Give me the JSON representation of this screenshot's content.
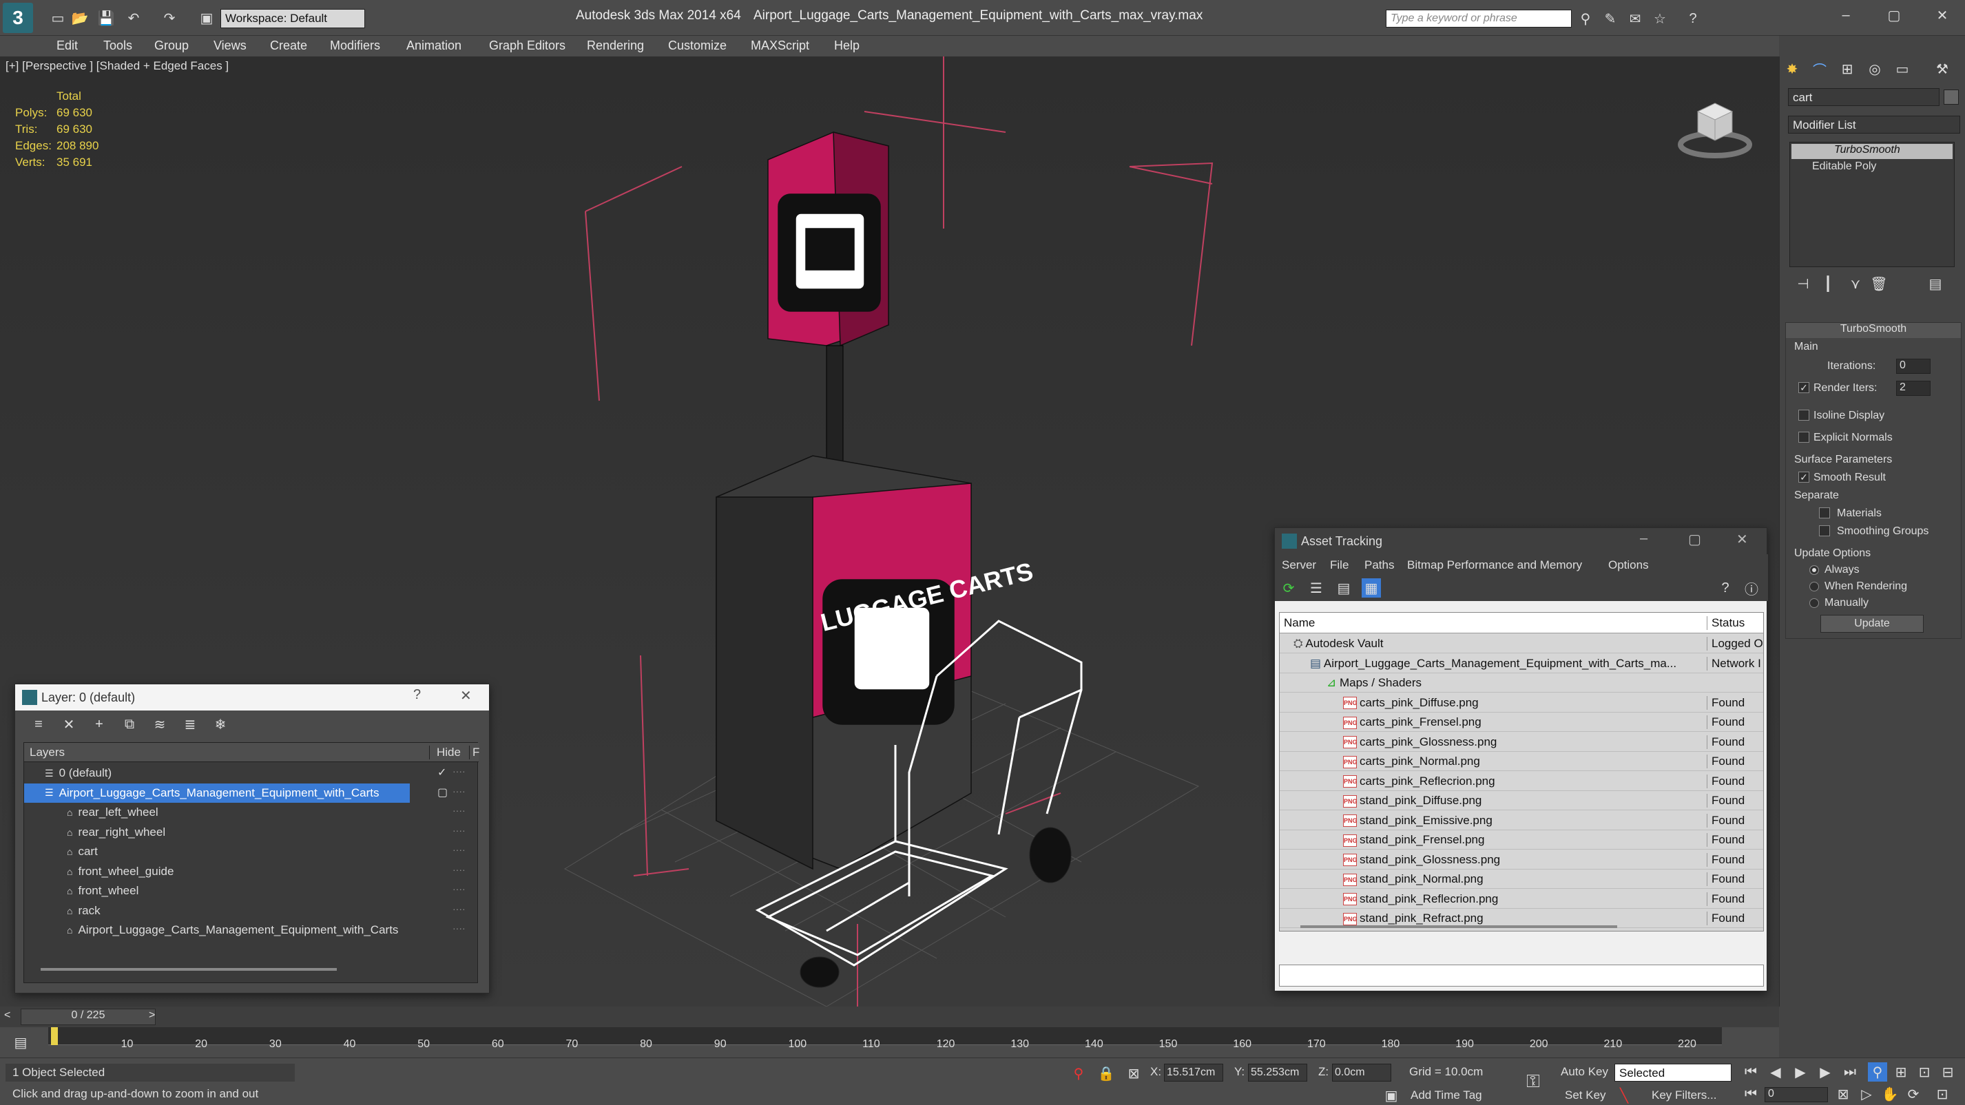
{
  "titlebar": {
    "app": "Autodesk 3ds Max  2014 x64",
    "file": "Airport_Luggage_Carts_Management_Equipment_with_Carts_max_vray.max",
    "workspace": "Workspace: Default",
    "search_placeholder": "Type a keyword or phrase"
  },
  "menu": [
    "Edit",
    "Tools",
    "Group",
    "Views",
    "Create",
    "Modifiers",
    "Animation",
    "Graph Editors",
    "Rendering",
    "Customize",
    "MAXScript",
    "Help"
  ],
  "viewport": {
    "label": "[+] [Perspective ] [Shaded + Edged Faces ]",
    "stats": {
      "header": "Total",
      "rows": [
        {
          "label": "Polys:",
          "value": "69 630"
        },
        {
          "label": "Tris:",
          "value": "69 630"
        },
        {
          "label": "Edges:",
          "value": "208 890"
        },
        {
          "label": "Verts:",
          "value": "35 691"
        }
      ]
    },
    "sign_text": "LUGGAGE CARTS"
  },
  "command_panel": {
    "search_value": "cart",
    "modifier_list": "Modifier List",
    "stack": [
      "TurboSmooth",
      "Editable Poly"
    ],
    "rollout_title": "TurboSmooth",
    "main_label": "Main",
    "iterations_label": "Iterations:",
    "iterations_value": "0",
    "render_iters_label": "Render Iters:",
    "render_iters_value": "2",
    "isoline": "Isoline Display",
    "explicit_normals": "Explicit Normals",
    "surface_params": "Surface Parameters",
    "smooth_result": "Smooth Result",
    "separate": "Separate",
    "materials": "Materials",
    "smoothing_groups": "Smoothing Groups",
    "update_options": "Update Options",
    "always": "Always",
    "when_rendering": "When Rendering",
    "manually": "Manually",
    "update_button": "Update"
  },
  "layer_window": {
    "title": "Layer: 0 (default)",
    "help": "?",
    "col_layers": "Layers",
    "col_hide": "Hide",
    "col_f": "F",
    "rows": [
      {
        "label": "0 (default)",
        "level": 0
      },
      {
        "label": "Airport_Luggage_Carts_Management_Equipment_with_Carts",
        "level": 0,
        "selected": true
      },
      {
        "label": "rear_left_wheel",
        "level": 1
      },
      {
        "label": "rear_right_wheel",
        "level": 1
      },
      {
        "label": "cart",
        "level": 1
      },
      {
        "label": "front_wheel_guide",
        "level": 1
      },
      {
        "label": "front_wheel",
        "level": 1
      },
      {
        "label": "rack",
        "level": 1
      },
      {
        "label": "Airport_Luggage_Carts_Management_Equipment_with_Carts",
        "level": 1
      }
    ]
  },
  "asset_tracking": {
    "title": "Asset Tracking",
    "menu": [
      "Server",
      "File",
      "Paths",
      "Bitmap Performance and Memory",
      "Options"
    ],
    "col_name": "Name",
    "col_status": "Status",
    "rows": [
      {
        "name": "Autodesk Vault",
        "status": "Logged O",
        "indent": 0
      },
      {
        "name": "Airport_Luggage_Carts_Management_Equipment_with_Carts_ma...",
        "status": "Network I",
        "indent": 1
      },
      {
        "name": "Maps / Shaders",
        "status": "",
        "indent": 2
      },
      {
        "name": "carts_pink_Diffuse.png",
        "status": "Found",
        "indent": 3
      },
      {
        "name": "carts_pink_Frensel.png",
        "status": "Found",
        "indent": 3
      },
      {
        "name": "carts_pink_Glossness.png",
        "status": "Found",
        "indent": 3
      },
      {
        "name": "carts_pink_Normal.png",
        "status": "Found",
        "indent": 3
      },
      {
        "name": "carts_pink_Reflecrion.png",
        "status": "Found",
        "indent": 3
      },
      {
        "name": "stand_pink_Diffuse.png",
        "status": "Found",
        "indent": 3
      },
      {
        "name": "stand_pink_Emissive.png",
        "status": "Found",
        "indent": 3
      },
      {
        "name": "stand_pink_Frensel.png",
        "status": "Found",
        "indent": 3
      },
      {
        "name": "stand_pink_Glossness.png",
        "status": "Found",
        "indent": 3
      },
      {
        "name": "stand_pink_Normal.png",
        "status": "Found",
        "indent": 3
      },
      {
        "name": "stand_pink_Reflecrion.png",
        "status": "Found",
        "indent": 3
      },
      {
        "name": "stand_pink_Refract.png",
        "status": "Found",
        "indent": 3
      }
    ]
  },
  "timeline": {
    "frame": "0 / 225",
    "ticks": [
      "10",
      "20",
      "30",
      "40",
      "50",
      "60",
      "70",
      "80",
      "90",
      "100",
      "110",
      "120",
      "130",
      "140",
      "150",
      "160",
      "170",
      "180",
      "190",
      "200",
      "210",
      "220"
    ]
  },
  "status": {
    "selected": "1 Object Selected",
    "hint": "Click and drag up-and-down to zoom in and out",
    "x_label": "X:",
    "x": "15.517cm",
    "y_label": "Y:",
    "y": "55.253cm",
    "z_label": "Z:",
    "z": "0.0cm",
    "grid": "Grid = 10.0cm",
    "auto_key": "Auto Key",
    "selected_dropdown": "Selected",
    "set_key": "Set Key",
    "key_filters": "Key Filters...",
    "add_time_tag": "Add Time Tag",
    "frame_value": "0"
  },
  "colors": {
    "accent": "#3a7bd5",
    "pink": "#c2185b",
    "grid": "#c04060"
  }
}
